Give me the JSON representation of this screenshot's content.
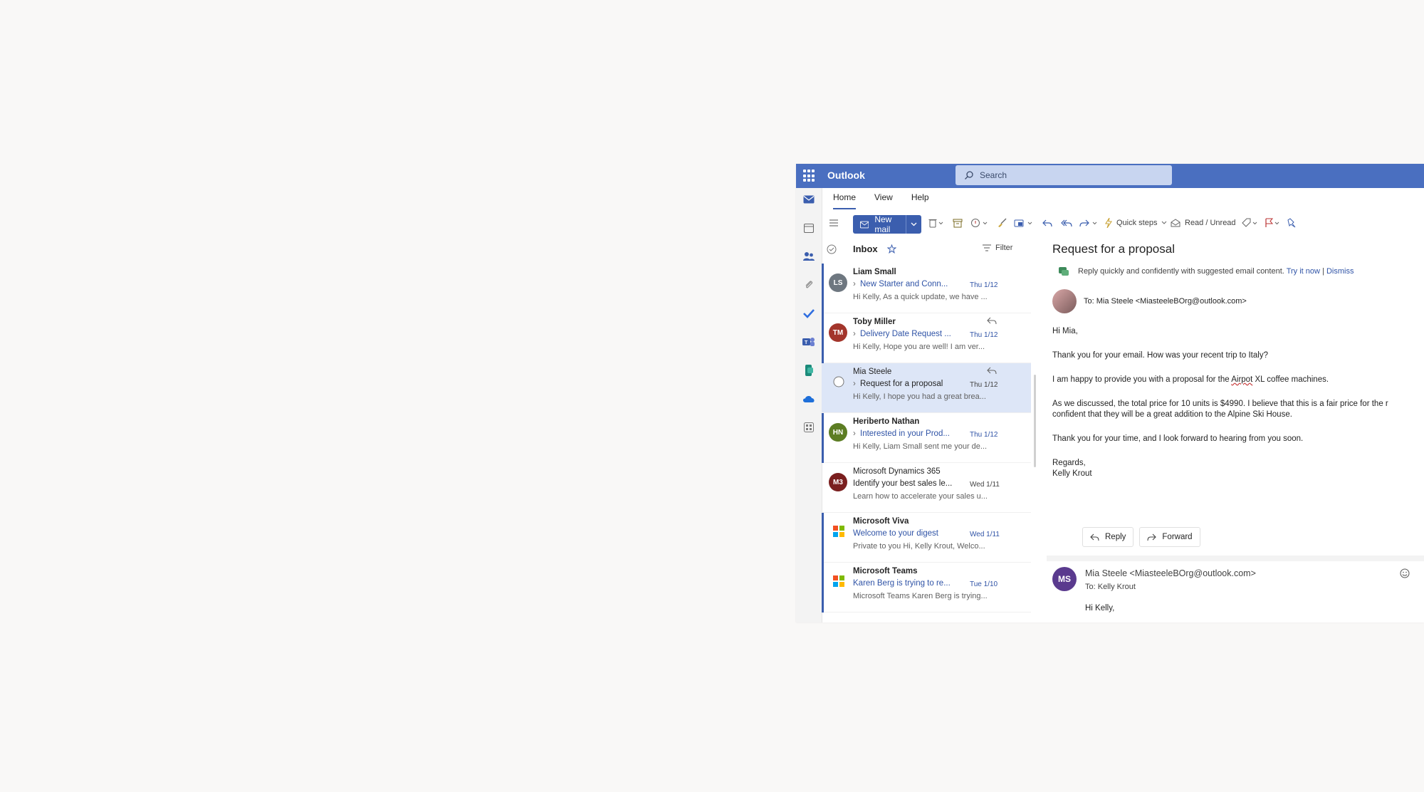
{
  "app": {
    "title": "Outlook"
  },
  "search": {
    "placeholder": "Search"
  },
  "menu": {
    "tabs": [
      "Home",
      "View",
      "Help"
    ]
  },
  "toolbar": {
    "new_mail_label": "New mail",
    "quick_steps_label": "Quick steps",
    "read_unread_label": "Read / Unread"
  },
  "list": {
    "folder": "Inbox",
    "filter_label": "Filter",
    "messages": [
      {
        "initials": "LS",
        "color": "#6e7780",
        "sender": "Liam Small",
        "subject": "New Starter and Conn...",
        "date": "Thu 1/12",
        "preview": "Hi Kelly, As a quick update, we have ..."
      },
      {
        "initials": "TM",
        "color": "#a3352b",
        "sender": "Toby Miller",
        "subject": "Delivery Date Request ...",
        "date": "Thu 1/12",
        "preview": "Hi Kelly, Hope you are well! I am ver..."
      },
      {
        "initials": "",
        "color": "",
        "sender": "Mia Steele",
        "subject": "Request for a proposal",
        "date": "Thu 1/12",
        "preview": "Hi Kelly, I hope you had a great brea..."
      },
      {
        "initials": "HN",
        "color": "#5c7d23",
        "sender": "Heriberto Nathan",
        "subject": "Interested in your Prod...",
        "date": "Thu 1/12",
        "preview": "Hi Kelly, Liam Small sent me your de..."
      },
      {
        "initials": "M3",
        "color": "#7a1f1f",
        "sender": "Microsoft Dynamics 365",
        "subject": "Identify your best sales le...",
        "date": "Wed 1/11",
        "preview": "Learn how to accelerate your sales u..."
      },
      {
        "initials": "",
        "color": "",
        "sender": "Microsoft Viva",
        "subject": "Welcome to your digest",
        "date": "Wed 1/11",
        "preview": "Private to you Hi, Kelly Krout, Welco..."
      },
      {
        "initials": "",
        "color": "",
        "sender": "Microsoft Teams",
        "subject": "Karen Berg is trying to re...",
        "date": "Tue 1/10",
        "preview": "Microsoft Teams Karen Berg is trying..."
      }
    ]
  },
  "reading": {
    "subject": "Request for a proposal",
    "copilot_text": "Reply quickly and confidently with suggested email content.",
    "copilot_try": "Try it now",
    "copilot_sep": "|",
    "copilot_dismiss": "Dismiss",
    "to_line": "To:  Mia Steele <MiasteeleBOrg@outlook.com>",
    "greeting": "Hi Mia,",
    "p1": "Thank you for your email. How was your recent trip to Italy?",
    "p2_pre": "I am happy to provide you with a proposal for the ",
    "p2_mid": "Airpot",
    "p2_post": " XL coffee machines.",
    "p3a": "As we discussed, the total price for 10 units is $4990. I believe that this is a fair price for the r",
    "p3b": "confident that they will be a great addition to the Alpine Ski House.",
    "p4": "Thank you for your time, and I look forward to hearing from you soon.",
    "sig1": "Regards,",
    "sig2": "Kelly Krout",
    "reply_label": "Reply",
    "forward_label": "Forward",
    "second": {
      "initials": "MS",
      "from": "Mia Steele <MiasteeleBOrg@outlook.com>",
      "to": "To:  Kelly Krout",
      "greeting": "Hi Kelly,"
    }
  },
  "colors": {
    "brand": "#4a6fc0",
    "accent": "#3b5eae",
    "selected": "#dde6f7"
  }
}
